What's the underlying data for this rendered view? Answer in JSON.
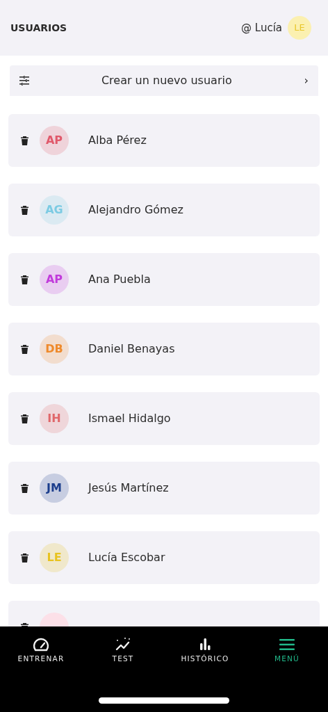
{
  "header": {
    "title": "USUARIOS",
    "user": "@ Lucía",
    "user_initials": "LE"
  },
  "create_button": {
    "label": "Crear un nuevo usuario",
    "chevron": "›"
  },
  "users": [
    {
      "initials": "AP",
      "name": "Alba Pérez",
      "color": "#e0596b"
    },
    {
      "initials": "AG",
      "name": "Alejandro Gómez",
      "color": "#7ccbe3"
    },
    {
      "initials": "AP",
      "name": "Ana Puebla",
      "color": "#c13bdb"
    },
    {
      "initials": "DB",
      "name": "Daniel Benayas",
      "color": "#ee8a2c"
    },
    {
      "initials": "IH",
      "name": "Ismael Hidalgo",
      "color": "#e0676a"
    },
    {
      "initials": "JM",
      "name": "Jesús Martínez",
      "color": "#1b3d8c"
    },
    {
      "initials": "LE",
      "name": "Lucía Escobar",
      "color": "#e8c320"
    }
  ],
  "partial_user": {
    "color": "#fce0e8"
  },
  "tabs": [
    {
      "label": "ENTRENAR",
      "kind": "gauge",
      "selected": false
    },
    {
      "label": "TEST",
      "kind": "sparkle",
      "selected": false
    },
    {
      "label": "HISTÓRICO",
      "kind": "bars",
      "selected": false
    },
    {
      "label": "MENÚ",
      "kind": "menu",
      "selected": true
    }
  ]
}
